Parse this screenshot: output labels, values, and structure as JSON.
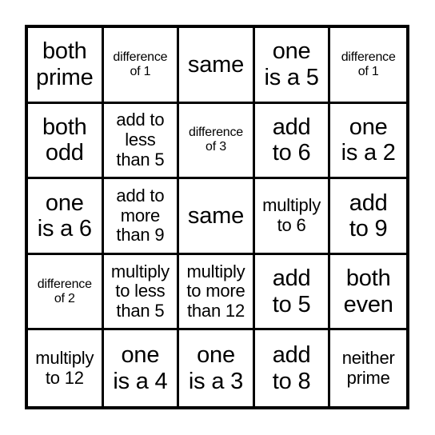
{
  "card": {
    "type": "bingo-card",
    "rows": 5,
    "columns": 5,
    "border_color": "#000000",
    "cell_background": "#ffffff",
    "text_color": "#000000",
    "cells": [
      [
        {
          "text": "both\nprime",
          "size": "lg"
        },
        {
          "text": "difference\nof 1",
          "size": "sm"
        },
        {
          "text": "same",
          "size": "lg"
        },
        {
          "text": "one\nis a 5",
          "size": "lg"
        },
        {
          "text": "difference\nof 1",
          "size": "sm"
        }
      ],
      [
        {
          "text": "both\nodd",
          "size": "lg"
        },
        {
          "text": "add to\nless\nthan 5",
          "size": "md"
        },
        {
          "text": "difference\nof 3",
          "size": "sm"
        },
        {
          "text": "add\nto 6",
          "size": "lg"
        },
        {
          "text": "one\nis a 2",
          "size": "lg"
        }
      ],
      [
        {
          "text": "one\nis a 6",
          "size": "lg"
        },
        {
          "text": "add to\nmore\nthan 9",
          "size": "md"
        },
        {
          "text": "same",
          "size": "lg"
        },
        {
          "text": "multiply\nto 6",
          "size": "md"
        },
        {
          "text": "add\nto 9",
          "size": "lg"
        }
      ],
      [
        {
          "text": "difference\nof 2",
          "size": "sm"
        },
        {
          "text": "multiply\nto less\nthan 5",
          "size": "md"
        },
        {
          "text": "multiply\nto more\nthan 12",
          "size": "md"
        },
        {
          "text": "add\nto 5",
          "size": "lg"
        },
        {
          "text": "both\neven",
          "size": "lg"
        }
      ],
      [
        {
          "text": "multiply\nto 12",
          "size": "md"
        },
        {
          "text": "one\nis a 4",
          "size": "lg"
        },
        {
          "text": "one\nis a 3",
          "size": "lg"
        },
        {
          "text": "add\nto 8",
          "size": "lg"
        },
        {
          "text": "neither\nprime",
          "size": "md"
        }
      ]
    ]
  }
}
